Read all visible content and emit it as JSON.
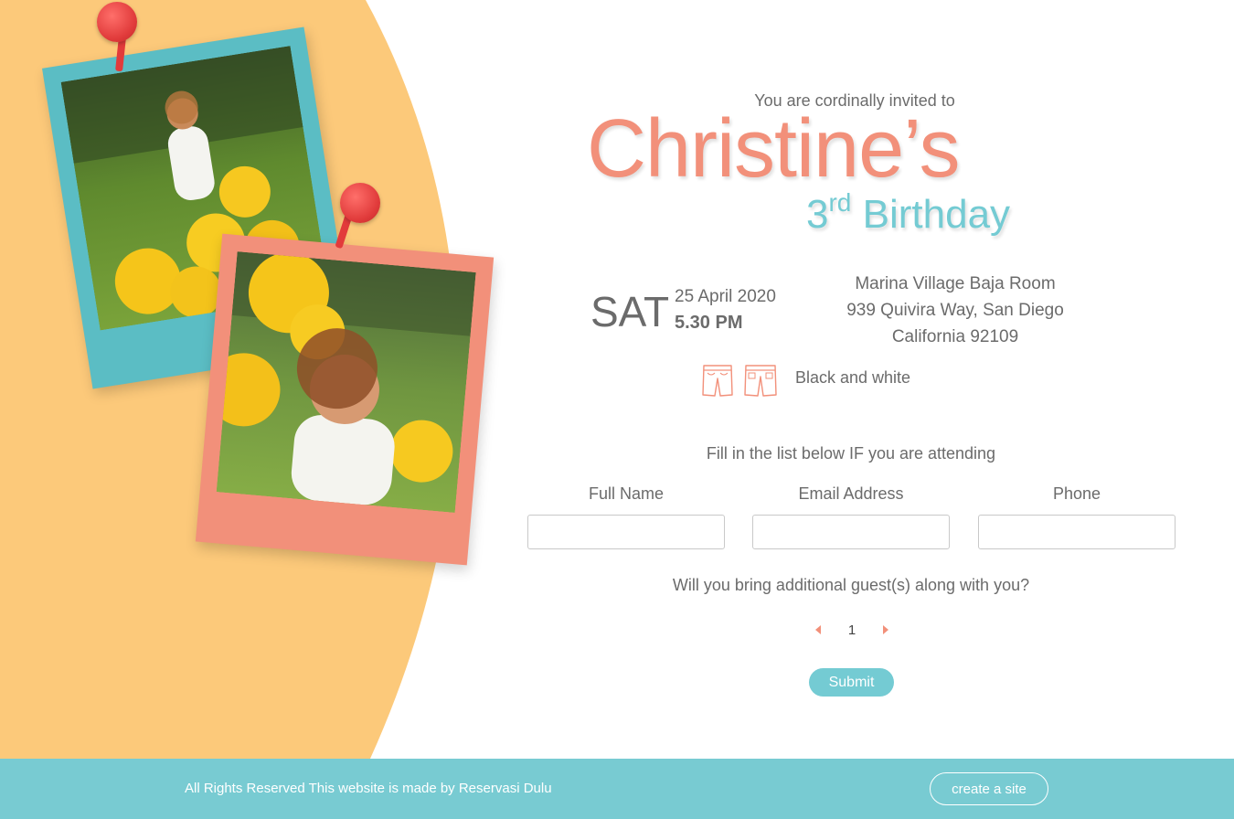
{
  "colors": {
    "accent_coral": "#f2907a",
    "accent_teal": "#74cbd3",
    "background_yellow": "#fcc97a",
    "footer_teal": "#78cbd2",
    "pin_red": "#e23b3b"
  },
  "invitation": {
    "intro": "You are cordinally invited to",
    "name": "Christine’s",
    "ordinal_number": "3",
    "ordinal_suffix": "rd",
    "occasion": "Birthday"
  },
  "event": {
    "day": "SAT",
    "date": "25 April 2020",
    "time": "5.30 PM"
  },
  "venue": {
    "line1": "Marina Village Baja Room",
    "line2": "939 Quivira Way, San Diego",
    "line3": "California 92109"
  },
  "dresscode": {
    "icons": [
      "shorts-icon",
      "trousers-icon"
    ],
    "text": "Black and white"
  },
  "rsvp": {
    "note": "Fill in the list below IF you are attending",
    "full_name_label": "Full Name",
    "full_name_value": "",
    "email_label": "Email Address",
    "email_value": "",
    "phone_label": "Phone",
    "phone_value": "",
    "guests_question": "Will you bring additional guest(s) along with you?",
    "guests_count": "1",
    "submit_label": "Submit"
  },
  "footer": {
    "text": "All Rights Reserved This website is made by Reservasi Dulu",
    "button_label": "create a site"
  }
}
